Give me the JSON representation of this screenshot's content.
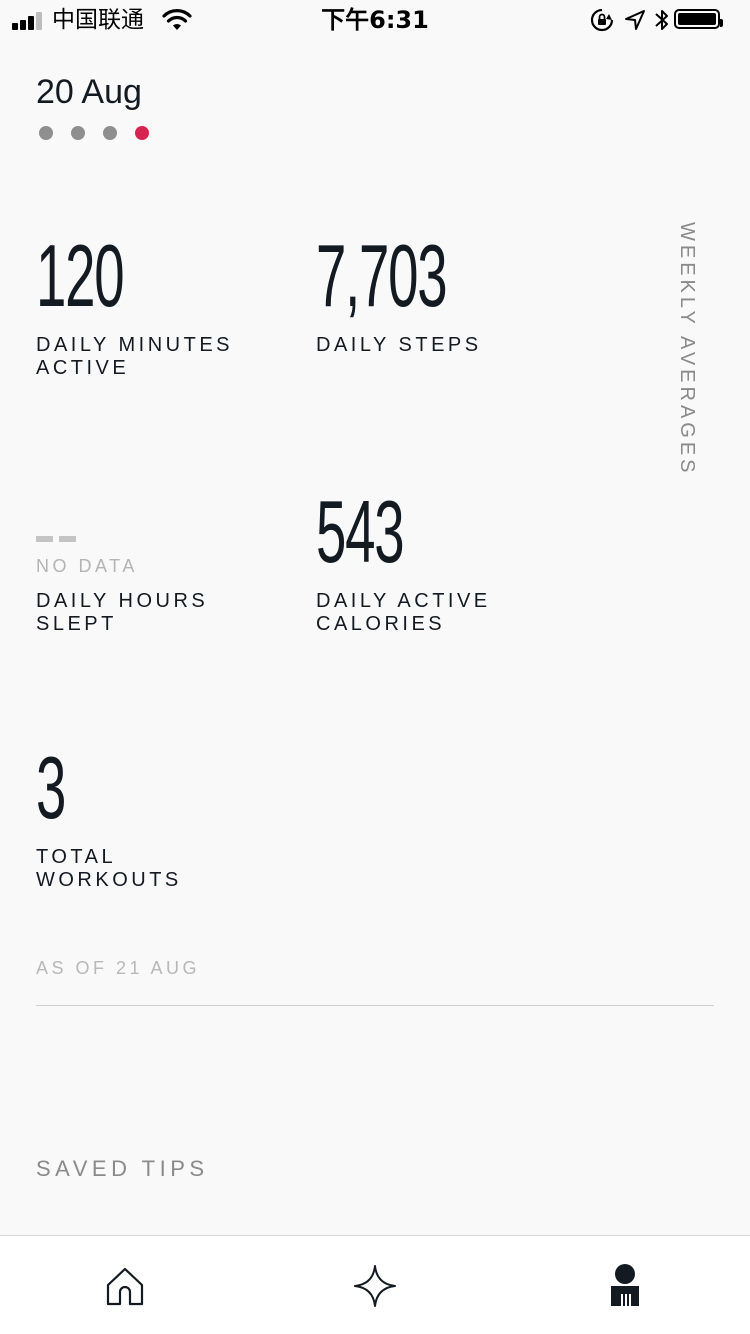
{
  "status_bar": {
    "carrier": "中国联通",
    "time": "下午6:31",
    "icons": [
      "signal-icon",
      "wifi-icon",
      "orientation-lock-icon",
      "location-icon",
      "bluetooth-icon",
      "battery-icon"
    ]
  },
  "header": {
    "date": "20 Aug",
    "pager": {
      "count": 4,
      "active_index": 3
    }
  },
  "side_label": "WEEKLY AVERAGES",
  "stats": {
    "minutes_active": {
      "value": "120",
      "label_line1": "DAILY MINUTES",
      "label_line2": "ACTIVE"
    },
    "steps": {
      "value": "7,703",
      "label_line1": "DAILY STEPS"
    },
    "hours_slept": {
      "no_data": "NO DATA",
      "label_line1": "DAILY HOURS",
      "label_line2": "SLEPT"
    },
    "active_calories": {
      "value": "543",
      "label_line1": "DAILY ACTIVE",
      "label_line2": "CALORIES"
    },
    "workouts": {
      "value": "3",
      "label_line1": "TOTAL",
      "label_line2": "WORKOUTS"
    }
  },
  "as_of": "AS OF 21 AUG",
  "saved_tips": "SAVED TIPS",
  "tab_bar": {
    "tabs": [
      {
        "icon": "home-icon"
      },
      {
        "icon": "sparkle-icon"
      },
      {
        "icon": "profile-icon",
        "active": true
      }
    ]
  },
  "colors": {
    "background": "#f9f9f9",
    "text": "#141a22",
    "accent": "#d7234f",
    "muted": "#8a8a8a"
  }
}
